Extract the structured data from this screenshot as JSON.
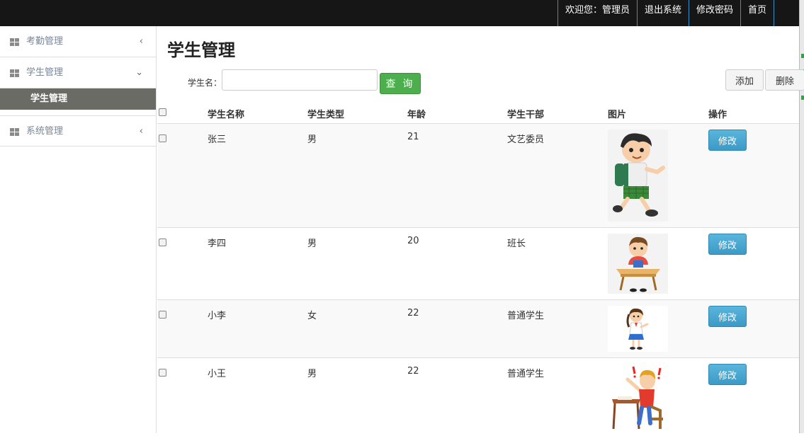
{
  "topnav": {
    "welcome": "欢迎您：管理员",
    "logout": "退出系统",
    "change_password": "修改密码",
    "home": "首页"
  },
  "sidebar": {
    "menus": [
      {
        "label": "考勤管理",
        "chevron": "‹",
        "expanded": false
      },
      {
        "label": "学生管理",
        "chevron": "⌄",
        "expanded": true,
        "children": [
          {
            "label": "学生管理",
            "active": true
          }
        ]
      },
      {
        "label": "系统管理",
        "chevron": "‹",
        "expanded": false
      }
    ]
  },
  "main": {
    "title": "学生管理",
    "search": {
      "label": "学生名：",
      "value": "",
      "button": "查 询"
    },
    "add_button": "添加",
    "delete_button": "删除"
  },
  "table": {
    "headers": [
      "学生名称",
      "学生类型",
      "年龄",
      "学生干部",
      "图片",
      "操作"
    ],
    "rows": [
      {
        "name": "张三",
        "type": "男",
        "age": "21",
        "cadre": "文艺委员",
        "picture": "boy-walking-backpack-illustration",
        "action": "修改"
      },
      {
        "name": "李四",
        "type": "男",
        "age": "20",
        "cadre": "班长",
        "picture": "boy-at-desk-reading-illustration",
        "action": "修改"
      },
      {
        "name": "小李",
        "type": "女",
        "age": "22",
        "cadre": "普通学生",
        "picture": "girl-student-illustration",
        "action": "修改"
      },
      {
        "name": "小王",
        "type": "男",
        "age": "22",
        "cadre": "普通学生",
        "picture": "boy-raising-hand-at-desk-illustration",
        "action": "修改"
      }
    ]
  },
  "colors": {
    "topbar": "#161616",
    "topnav_divider": "#3a8fc4",
    "active_submenu": "#6b6b66",
    "query_button": "#4cae4c",
    "edit_button": "#4aa6cf"
  }
}
